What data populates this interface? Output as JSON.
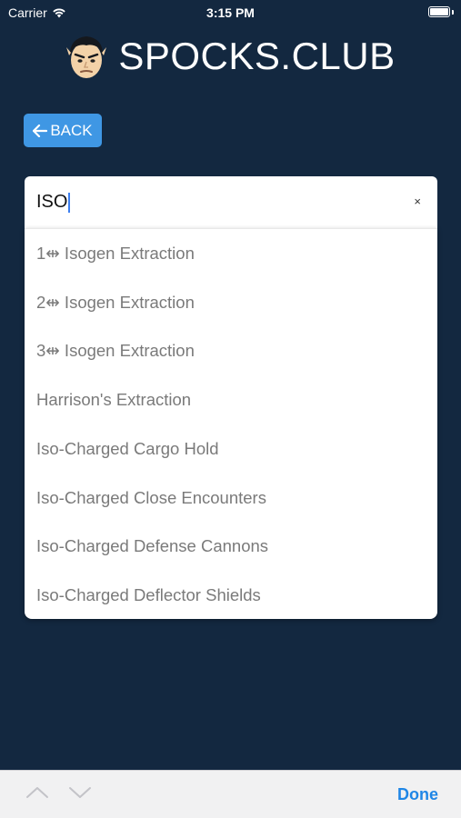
{
  "status_bar": {
    "carrier": "Carrier",
    "time": "3:15 PM"
  },
  "header": {
    "brand": "SPOCKS.CLUB"
  },
  "back_button": {
    "label": "BACK"
  },
  "search": {
    "value": "ISO",
    "clear_glyph": "×"
  },
  "dropdown": {
    "options": [
      "1⇹ Isogen Extraction",
      "2⇹ Isogen Extraction",
      "3⇹ Isogen Extraction",
      "Harrison's Extraction",
      "Iso-Charged Cargo Hold",
      "Iso-Charged Close Encounters",
      "Iso-Charged Defense Cannons",
      "Iso-Charged Deflector Shields"
    ]
  },
  "keyboard_toolbar": {
    "done_label": "Done"
  },
  "colors": {
    "background": "#132840",
    "accent": "#3f97e4",
    "done": "#1f86e6"
  },
  "icons": [
    "wifi-icon",
    "battery-icon",
    "logo-face-icon",
    "arrow-left-icon",
    "close-icon",
    "chevron-up-icon",
    "chevron-down-icon"
  ]
}
